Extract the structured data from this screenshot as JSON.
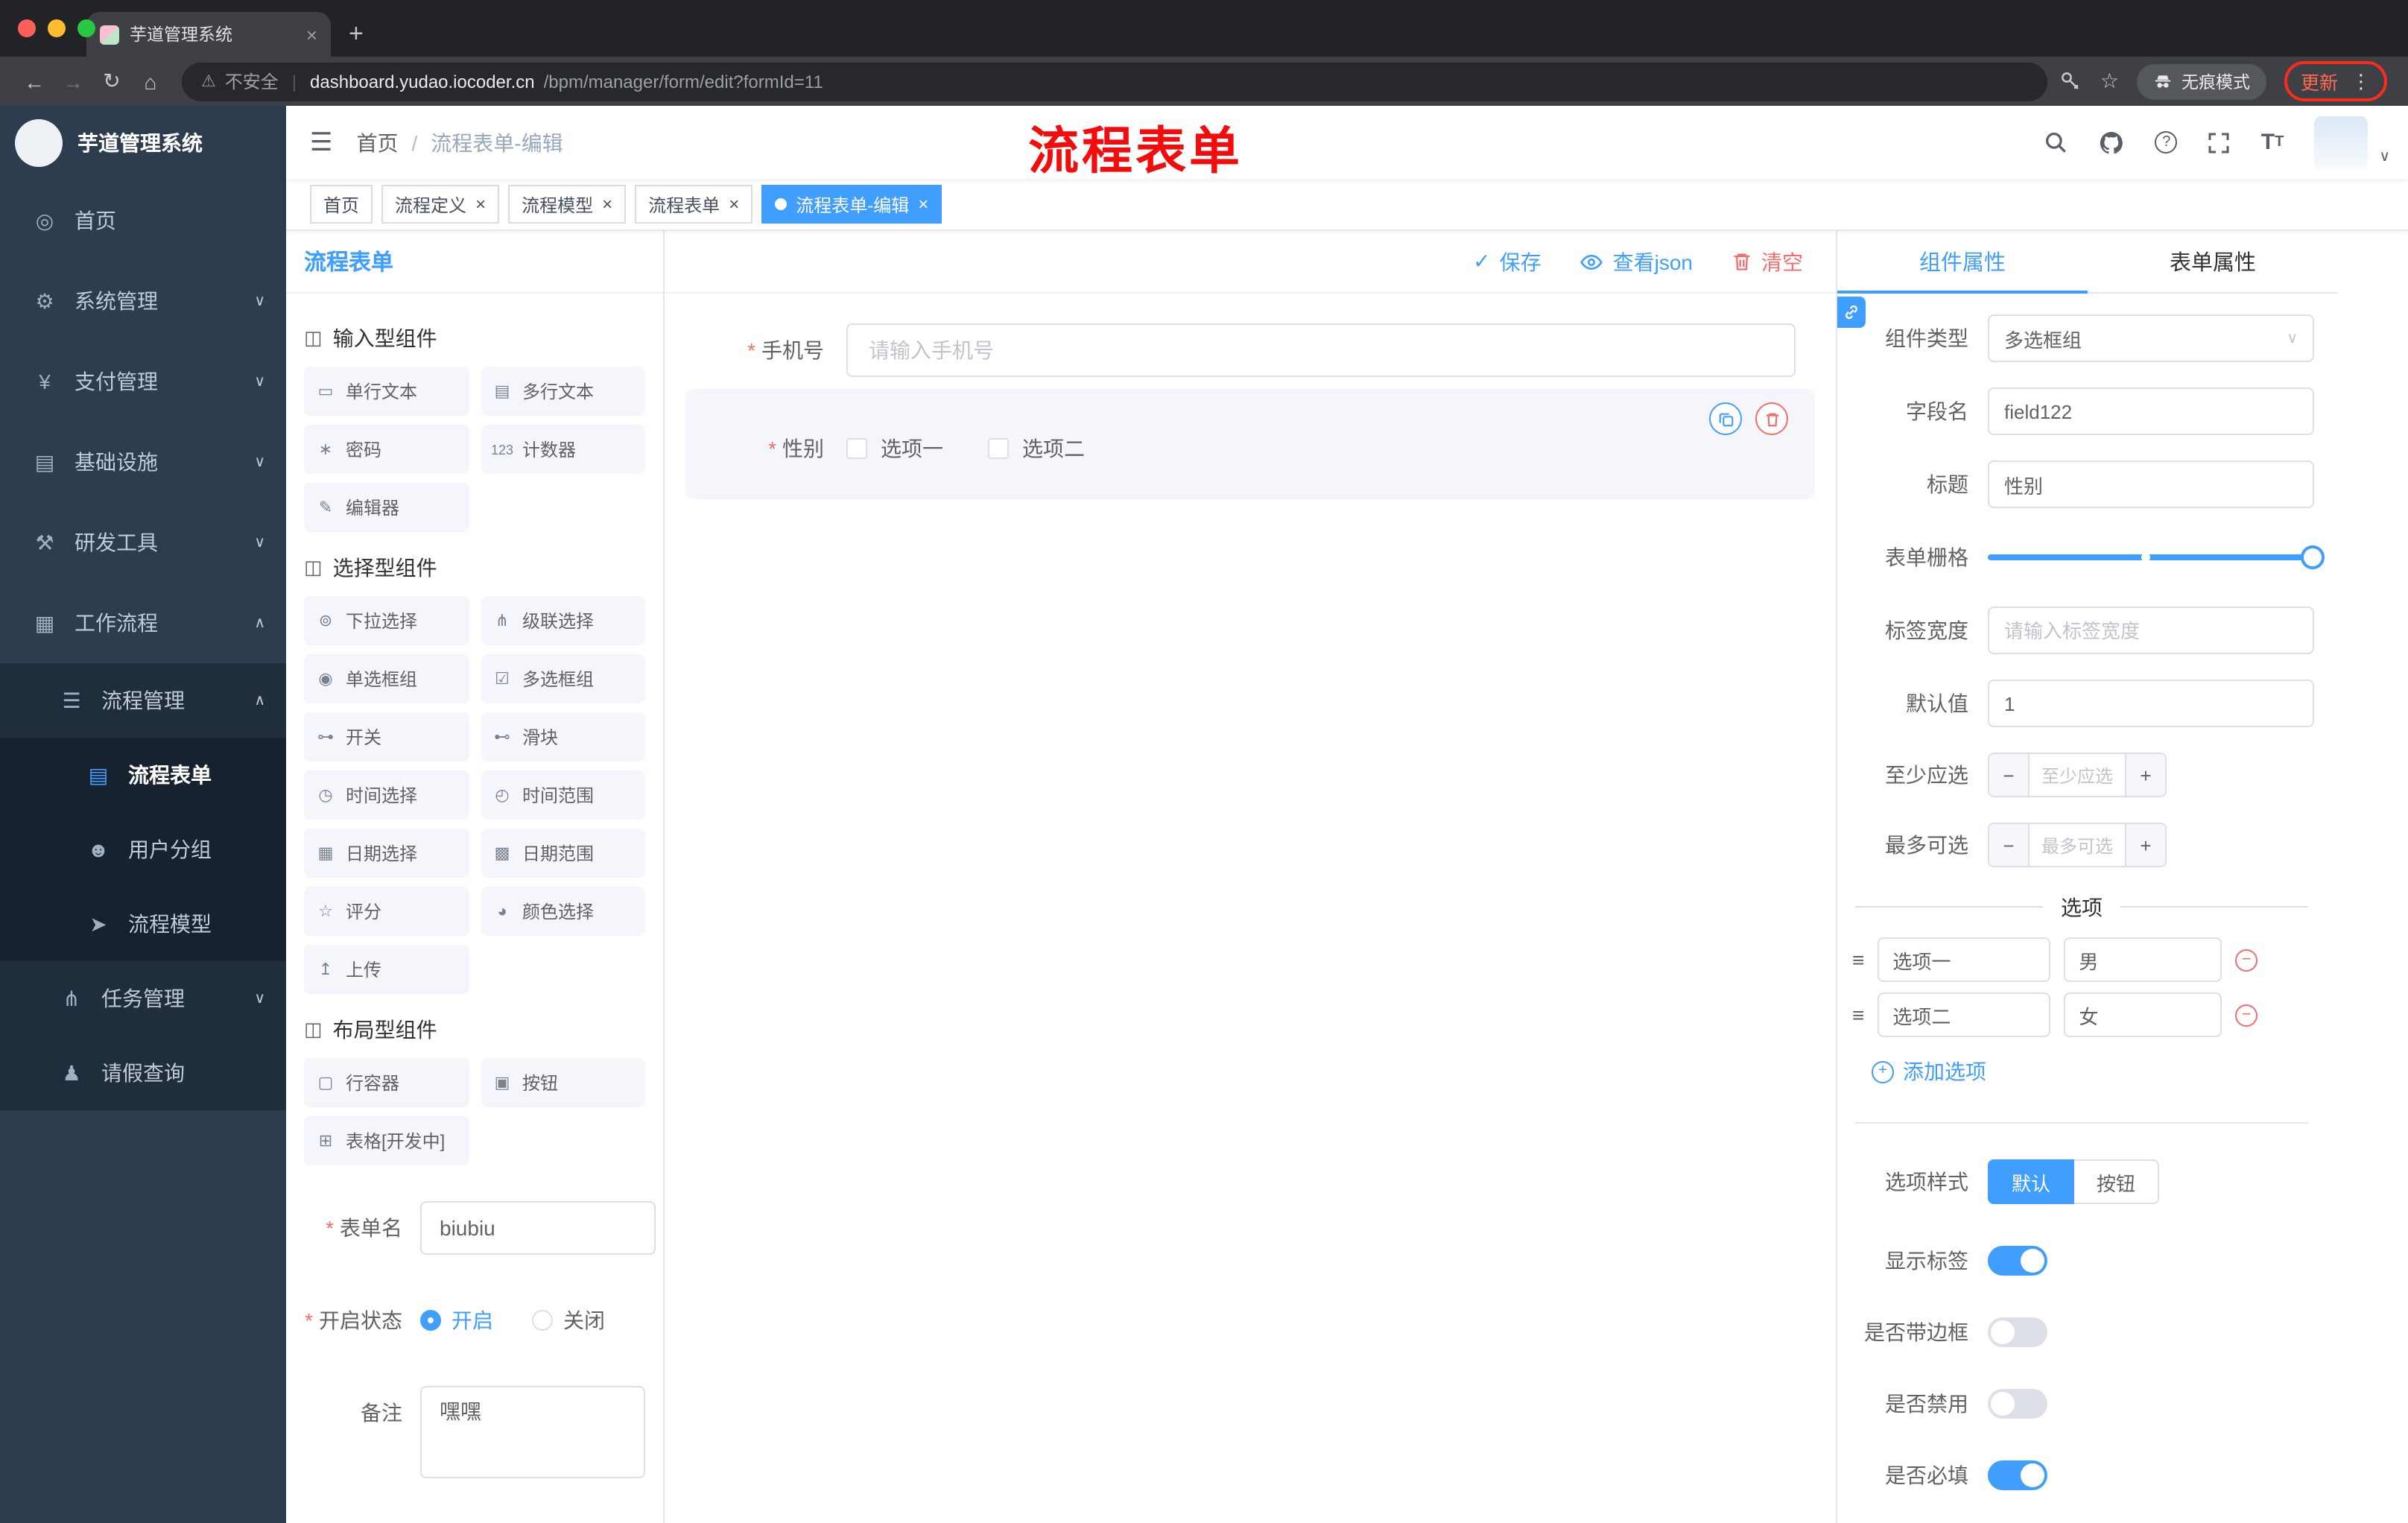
{
  "browser": {
    "tab_title": "芋道管理系统",
    "security_label": "不安全",
    "url_host": "dashboard.yudao.iocoder.cn",
    "url_path": "/bpm/manager/form/edit?formId=11",
    "incognito_label": "无痕模式",
    "update_label": "更新"
  },
  "sidebar": {
    "logo_title": "芋道管理系统",
    "menu": [
      {
        "label": "首页"
      },
      {
        "label": "系统管理"
      },
      {
        "label": "支付管理"
      },
      {
        "label": "基础设施"
      },
      {
        "label": "研发工具"
      },
      {
        "label": "工作流程"
      },
      {
        "label": "流程管理"
      },
      {
        "label": "流程表单"
      },
      {
        "label": "用户分组"
      },
      {
        "label": "流程模型"
      },
      {
        "label": "任务管理"
      },
      {
        "label": "请假查询"
      }
    ]
  },
  "navbar": {
    "breadcrumb_home": "首页",
    "breadcrumb_current": "流程表单-编辑",
    "annotation": "流程表单"
  },
  "tags": [
    {
      "label": "首页"
    },
    {
      "label": "流程定义"
    },
    {
      "label": "流程模型"
    },
    {
      "label": "流程表单"
    },
    {
      "label": "流程表单-编辑"
    }
  ],
  "palette": {
    "title": "流程表单",
    "group_input": "输入型组件",
    "group_select": "选择型组件",
    "group_layout": "布局型组件",
    "items_input": [
      "单行文本",
      "多行文本",
      "密码",
      "计数器",
      "编辑器"
    ],
    "items_select": [
      "下拉选择",
      "级联选择",
      "单选框组",
      "多选框组",
      "开关",
      "滑块",
      "时间选择",
      "时间范围",
      "日期选择",
      "日期范围",
      "评分",
      "颜色选择",
      "上传"
    ],
    "items_layout": [
      "行容器",
      "按钮",
      "表格[开发中]"
    ],
    "form": {
      "name_label": "表单名",
      "name_value": "biubiu",
      "status_label": "开启状态",
      "status_on": "开启",
      "status_off": "关闭",
      "remark_label": "备注",
      "remark_value": "嘿嘿"
    }
  },
  "canvas": {
    "save_label": "保存",
    "view_json_label": "查看json",
    "clear_label": "清空",
    "phone": {
      "label": "手机号",
      "placeholder": "请输入手机号"
    },
    "gender": {
      "label": "性别",
      "option1": "选项一",
      "option2": "选项二"
    }
  },
  "inspector": {
    "tab_component": "组件属性",
    "tab_form": "表单属性",
    "rows": {
      "component_type": {
        "label": "组件类型",
        "value": "多选框组"
      },
      "field_name": {
        "label": "字段名",
        "value": "field122"
      },
      "title": {
        "label": "标题",
        "value": "性别"
      },
      "grid": {
        "label": "表单栅格"
      },
      "label_width": {
        "label": "标签宽度",
        "placeholder": "请输入标签宽度"
      },
      "default_value": {
        "label": "默认值",
        "value": "1"
      },
      "min_select": {
        "label": "至少应选",
        "placeholder": "至少应选"
      },
      "max_select": {
        "label": "最多可选",
        "placeholder": "最多可选"
      }
    },
    "options": {
      "divider": "选项",
      "row1": {
        "label": "选项一",
        "value": "男"
      },
      "row2": {
        "label": "选项二",
        "value": "女"
      },
      "add": "添加选项"
    },
    "style": {
      "label": "选项样式",
      "default": "默认",
      "button": "按钮"
    },
    "switches": {
      "show_label": "显示标签",
      "border": "是否带边框",
      "disabled": "是否禁用",
      "required": "是否必填"
    }
  }
}
